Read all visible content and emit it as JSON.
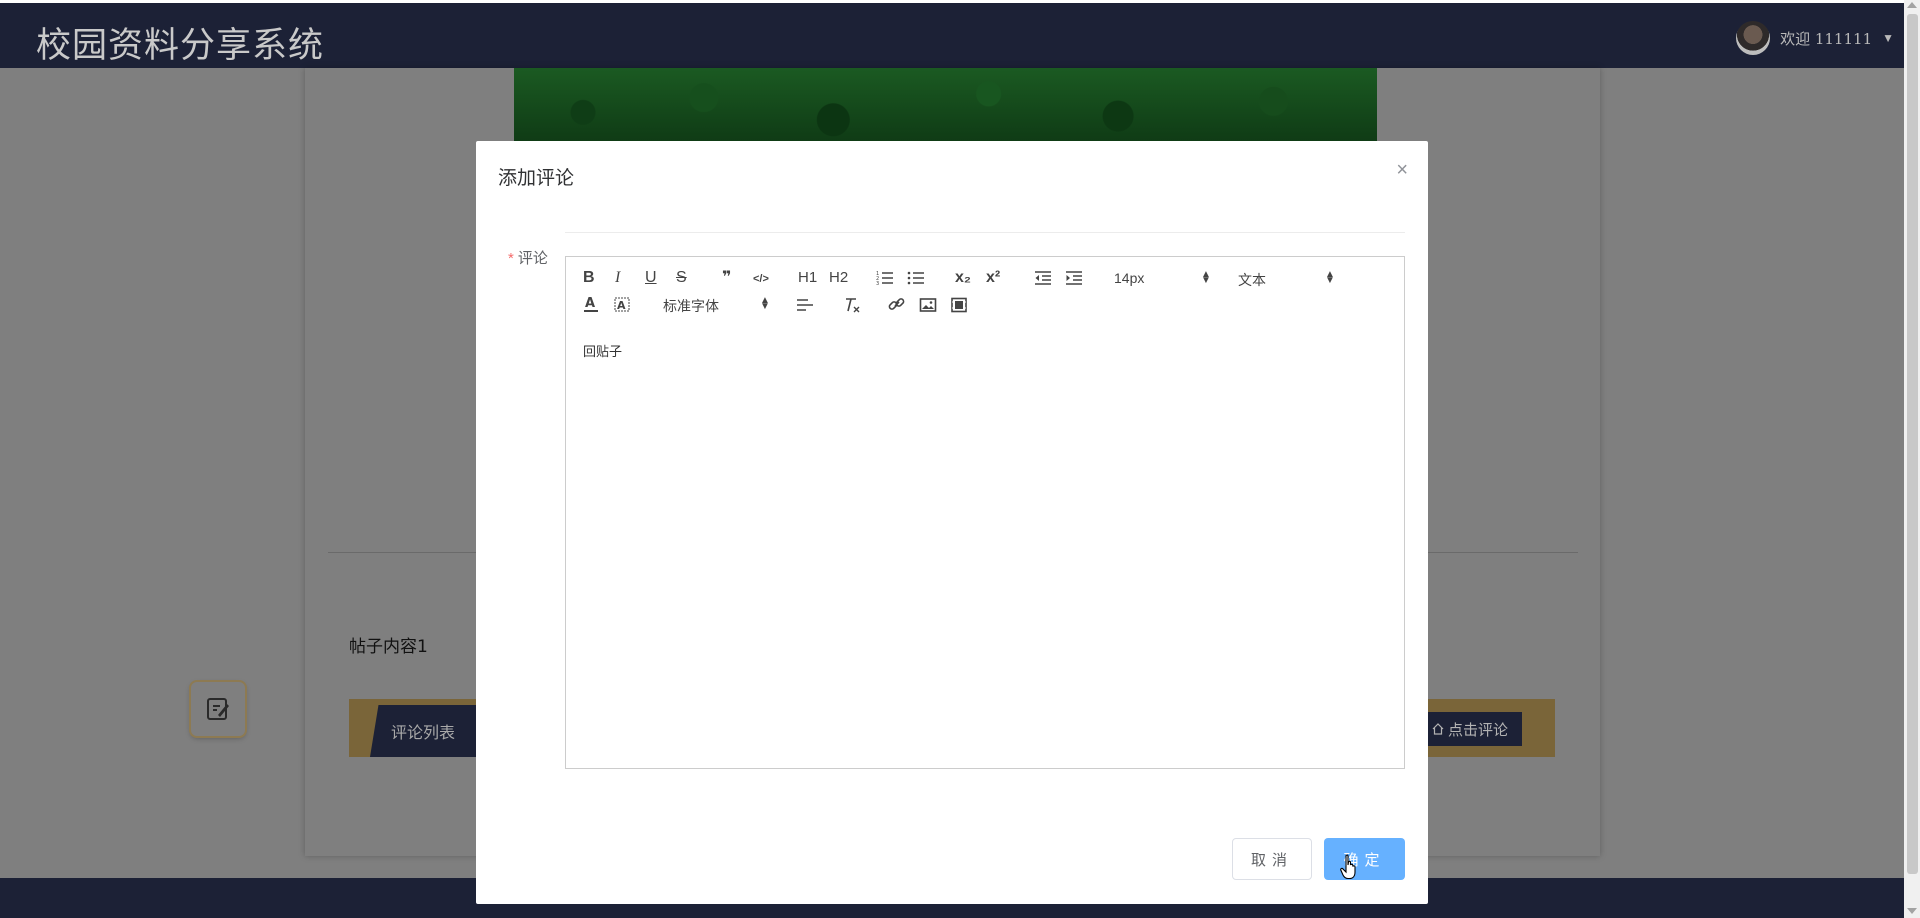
{
  "header": {
    "site_title": "校园资料分享系统",
    "welcome_text": "欢迎 111111",
    "caret": "▼"
  },
  "post": {
    "content": "帖子内容1",
    "comment_list_tab": "评论列表",
    "click_comment_button": "点击评论"
  },
  "modal": {
    "title": "添加评论",
    "close": "×",
    "field_label": "评论",
    "required_mark": "*",
    "toolbar": {
      "bold": "B",
      "italic": "I",
      "underline": "U",
      "strike": "S",
      "blockquote": "❞",
      "code_block": "</>",
      "h1": "H1",
      "h2": "H2",
      "subscript": "x₂",
      "superscript": "x²",
      "font_size": "14px",
      "header_select": "文本",
      "font_family": "标准字体"
    },
    "editor_text": "回贴子",
    "cancel_button": "取消",
    "confirm_button": "确定"
  }
}
